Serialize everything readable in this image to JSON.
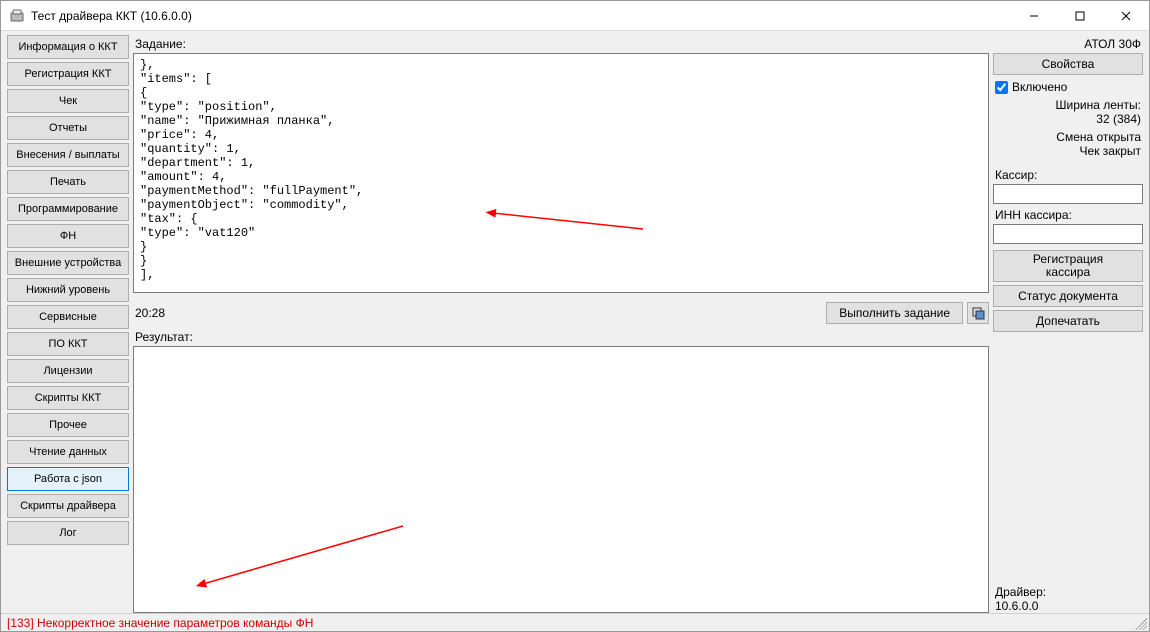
{
  "window": {
    "title": "Тест драйвера ККТ (10.6.0.0)"
  },
  "sidebar": {
    "items": [
      {
        "label": "Информация о ККТ"
      },
      {
        "label": "Регистрация ККТ"
      },
      {
        "label": "Чек"
      },
      {
        "label": "Отчеты"
      },
      {
        "label": "Внесения / выплаты"
      },
      {
        "label": "Печать"
      },
      {
        "label": "Программирование"
      },
      {
        "label": "ФН"
      },
      {
        "label": "Внешние устройства"
      },
      {
        "label": "Нижний уровень"
      },
      {
        "label": "Сервисные"
      },
      {
        "label": "ПО ККТ"
      },
      {
        "label": "Лицензии"
      },
      {
        "label": "Скрипты ККТ"
      },
      {
        "label": "Прочее"
      },
      {
        "label": "Чтение данных"
      },
      {
        "label": "Работа с json",
        "active": true
      },
      {
        "label": "Скрипты драйвера"
      },
      {
        "label": "Лог"
      }
    ]
  },
  "center": {
    "task_label": "Задание:",
    "task_text": "},\n\"items\": [\n{\n\"type\": \"position\",\n\"name\": \"Прижимная планка\",\n\"price\": 4,\n\"quantity\": 1,\n\"department\": 1,\n\"amount\": 4,\n\"paymentMethod\": \"fullPayment\",\n\"paymentObject\": \"commodity\",\n\"tax\": {\n\"type\": \"vat120\"\n}\n}\n],",
    "time": "20:28",
    "exec_label": "Выполнить задание",
    "result_label": "Результат:",
    "result_text": ""
  },
  "right": {
    "device": "АТОЛ 30Ф",
    "props_btn": "Свойства",
    "enabled_label": "Включено",
    "enabled_checked": true,
    "tape_label": "Ширина ленты:",
    "tape_value": "32 (384)",
    "shift_status": "Смена открыта",
    "cheque_status": "Чек закрыт",
    "cashier_label": "Кассир:",
    "cashier_value": "",
    "inn_label": "ИНН кассира:",
    "inn_value": "",
    "reg_cashier_btn": "Регистрация\nкассира",
    "doc_status_btn": "Статус документа",
    "reprint_btn": "Допечатать",
    "driver_label": "Драйвер:",
    "driver_version": "10.6.0.0"
  },
  "status": {
    "error": "[133] Некорректное значение параметров команды ФН"
  }
}
